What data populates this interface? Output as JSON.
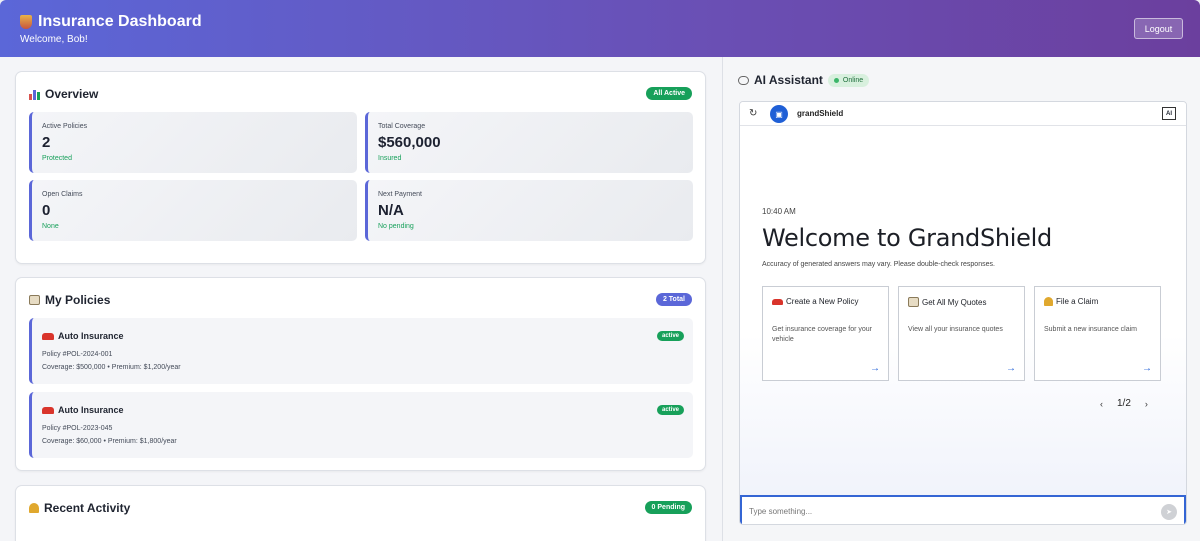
{
  "header": {
    "title": "Insurance Dashboard",
    "welcome": "Welcome, Bob!",
    "logout_label": "Logout"
  },
  "overview": {
    "title": "Overview",
    "badge": "All Active",
    "stats": [
      {
        "label": "Active Policies",
        "value": "2",
        "sub": "Protected"
      },
      {
        "label": "Total Coverage",
        "value": "$560,000",
        "sub": "Insured"
      },
      {
        "label": "Open Claims",
        "value": "0",
        "sub": "None"
      },
      {
        "label": "Next Payment",
        "value": "N/A",
        "sub": "No pending"
      }
    ]
  },
  "policies": {
    "title": "My Policies",
    "badge": "2 Total",
    "items": [
      {
        "title": "Auto Insurance",
        "number": "Policy #POL-2024-001",
        "details": "Coverage: $500,000 • Premium: $1,200/year",
        "status": "active"
      },
      {
        "title": "Auto Insurance",
        "number": "Policy #POL-2023-045",
        "details": "Coverage: $60,000 • Premium: $1,800/year",
        "status": "active"
      }
    ]
  },
  "activity": {
    "title": "Recent Activity",
    "badge": "0 Pending"
  },
  "assistant": {
    "title": "AI Assistant",
    "status": "Online",
    "bot_name": "grandShield",
    "ai_badge": "AI",
    "time": "10:40 AM",
    "welcome": "Welcome to GrandShield",
    "disclaimer": "Accuracy of generated answers may vary. Please double-check responses.",
    "quick_actions": [
      {
        "title": "Create a New Policy",
        "desc": "Get insurance coverage for your vehicle"
      },
      {
        "title": "Get All My Quotes",
        "desc": "View all your insurance quotes"
      },
      {
        "title": "File a Claim",
        "desc": "Submit a new insurance claim"
      }
    ],
    "pager": "1/2",
    "input_placeholder": "Type something..."
  },
  "colors": {
    "accent": "#5b67d8",
    "success": "#17a05a",
    "link": "#1f5fd6"
  }
}
